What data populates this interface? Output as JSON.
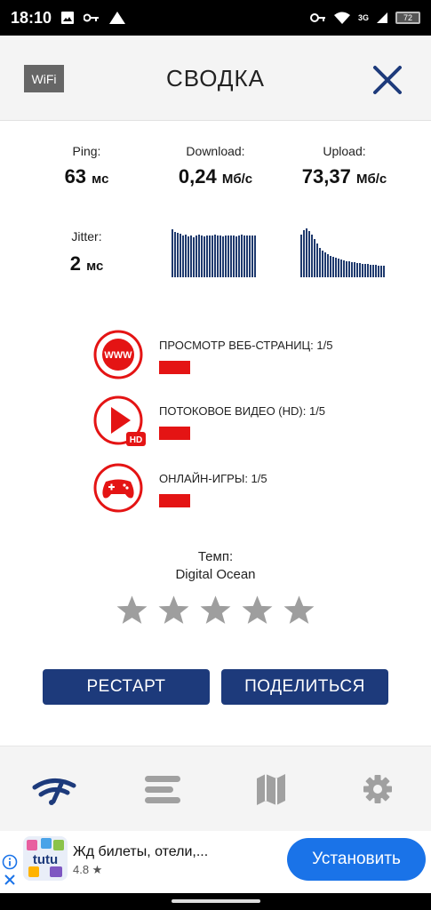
{
  "status": {
    "time": "18:10",
    "network": "3G",
    "battery": "72"
  },
  "header": {
    "badge": "WiFi",
    "title": "СВОДКА"
  },
  "stats": {
    "ping": {
      "label": "Ping:",
      "value": "63",
      "unit": "мс"
    },
    "download": {
      "label": "Download:",
      "value": "0,24",
      "unit": "Мб/с"
    },
    "upload": {
      "label": "Upload:",
      "value": "73,37",
      "unit": "Мб/с"
    },
    "jitter": {
      "label": "Jitter:",
      "value": "2",
      "unit": "мс"
    }
  },
  "quality": [
    {
      "label": "ПРОСМОТР ВЕБ-СТРАНИЦ: 1/5",
      "icon": "www-icon",
      "score": 0.2
    },
    {
      "label": "ПОТОКОВОЕ ВИДЕО (HD): 1/5",
      "icon": "hd-video-icon",
      "score": 0.2
    },
    {
      "label": "ОНЛАЙН-ИГРЫ: 1/5",
      "icon": "gamepad-icon",
      "score": 0.2
    }
  ],
  "quality_icon_text": {
    "www": "WWW",
    "hd": "HD"
  },
  "server": {
    "label": "Темп:",
    "name": "Digital Ocean"
  },
  "rating": {
    "value": 0,
    "max": 5
  },
  "buttons": {
    "restart": "РЕСТАРТ",
    "share": "ПОДЕЛИТЬСЯ"
  },
  "ad": {
    "title": "Жд билеты, отели,...",
    "rating": "4.8 ★",
    "install": "Установить",
    "logo_text": "tutu"
  },
  "colors": {
    "accent": "#1d3a7b",
    "bad": "#e41414",
    "graph": "#1f3a6e",
    "install": "#1a73e8"
  }
}
